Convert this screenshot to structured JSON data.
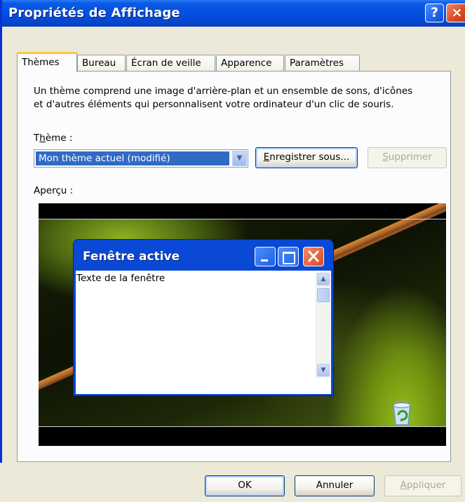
{
  "window": {
    "title": "Propriétés de Affichage",
    "help_label": "?",
    "close_label": "×"
  },
  "tabs": [
    {
      "label": "Thèmes",
      "active": true
    },
    {
      "label": "Bureau",
      "active": false
    },
    {
      "label": "Écran de veille",
      "active": false
    },
    {
      "label": "Apparence",
      "active": false
    },
    {
      "label": "Paramètres",
      "active": false
    }
  ],
  "themes_tab": {
    "description_line1": "Un thème comprend une image d'arrière-plan et un ensemble de sons, d'icônes",
    "description_line2": "et d'autres éléments qui personnalisent votre ordinateur d'un clic de souris.",
    "theme_label_pre": "T",
    "theme_label_mnemonic": "h",
    "theme_label_post": "ème :",
    "theme_value": "Mon thème actuel (modifié)",
    "save_as_mnemonic": "E",
    "save_as_rest": "nregistrer sous...",
    "delete_mnemonic": "S",
    "delete_rest": "upprimer",
    "preview_label": "Aperçu :"
  },
  "preview": {
    "window_title": "Fenêtre active",
    "window_text": "Texte de la fenêtre"
  },
  "footer": {
    "ok_label": "OK",
    "cancel_label": "Annuler",
    "apply_mnemonic": "A",
    "apply_rest": "ppliquer"
  },
  "colors": {
    "titlebar": "#0650e0",
    "selection": "#316ac5",
    "tab_highlight": "#ffc83c",
    "close_red": "#de4b22"
  }
}
